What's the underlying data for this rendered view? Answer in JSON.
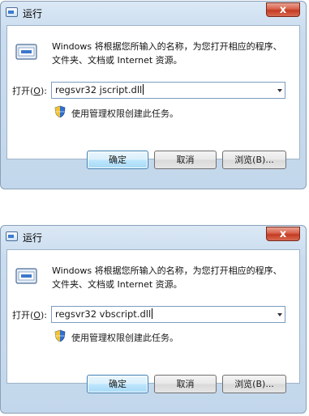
{
  "dialogs": [
    {
      "title": "运行",
      "close_glyph": "x",
      "description": "Windows 将根据您所输入的名称，为您打开相应的程序、文件夹、文档或 Internet 资源。",
      "open_label": "打开(",
      "open_label_key": "O",
      "open_label_end": "):",
      "command_value": "regsvr32 jscript.dll",
      "admin_note": "使用管理权限创建此任务。",
      "buttons": {
        "ok": "确定",
        "cancel": "取消",
        "browse": "浏览(B)..."
      }
    },
    {
      "title": "运行",
      "close_glyph": "x",
      "description": "Windows 将根据您所输入的名称，为您打开相应的程序、文件夹、文档或 Internet 资源。",
      "open_label": "打开(",
      "open_label_key": "O",
      "open_label_end": "):",
      "command_value": "regsvr32 vbscript.dll",
      "admin_note": "使用管理权限创建此任务。",
      "buttons": {
        "ok": "确定",
        "cancel": "取消",
        "browse": "浏览(B)..."
      }
    }
  ],
  "icons": {
    "title": "run-app-icon",
    "main": "run-program-icon",
    "shield": "uac-shield-icon",
    "dropdown": "chevron-down-icon"
  },
  "colors": {
    "window_frame": "#c9dcef",
    "close_button": "#c33b22",
    "default_button_border": "#3c7fb1"
  }
}
